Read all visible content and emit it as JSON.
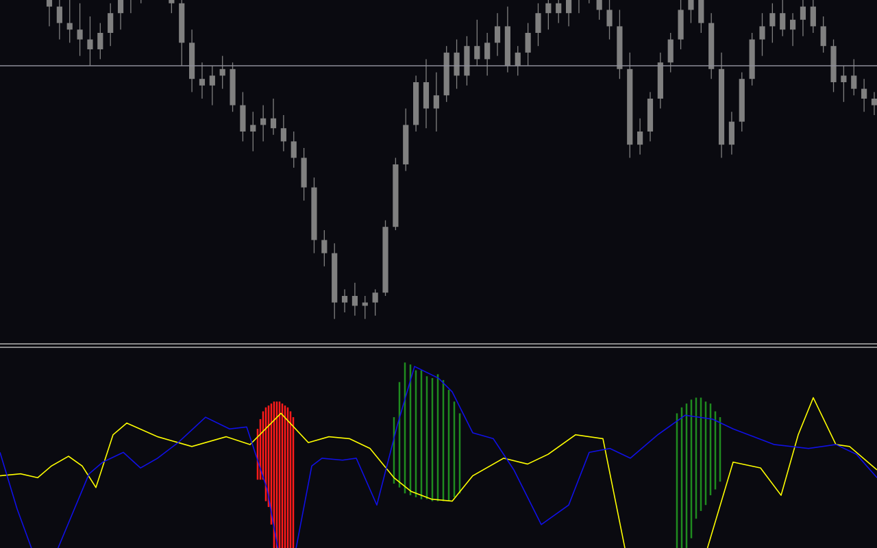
{
  "colors": {
    "background": "#0a0a10",
    "candle": "#808080",
    "level_line": "#8c8c98",
    "separator": "#b4b4b4",
    "fast_line": "#ffff00",
    "slow_line": "#1010e6",
    "hist_down": "#ff1a1a",
    "hist_up": "#1f8c1f"
  },
  "chart_data": [
    {
      "type": "candlestick",
      "title": "",
      "xlabel": "",
      "ylabel": "",
      "grid": false,
      "ylim": [
        0,
        100
      ],
      "horizontal_level": 80,
      "candles": [
        [
          100,
          104,
          92,
          98
        ],
        [
          98,
          106,
          88,
          93
        ],
        [
          93,
          102,
          87,
          91
        ],
        [
          91,
          99,
          83,
          88
        ],
        [
          88,
          95,
          80,
          85
        ],
        [
          85,
          93,
          82,
          90
        ],
        [
          90,
          99,
          86,
          96
        ],
        [
          96,
          104,
          91,
          101
        ],
        [
          101,
          108,
          96,
          104
        ],
        [
          104,
          109,
          99,
          106
        ],
        [
          106,
          110,
          101,
          104
        ],
        [
          104,
          108,
          100,
          102
        ],
        [
          102,
          106,
          96,
          99
        ],
        [
          99,
          102,
          80,
          87
        ],
        [
          87,
          91,
          72,
          76
        ],
        [
          76,
          81,
          70,
          74
        ],
        [
          74,
          80,
          68,
          77
        ],
        [
          77,
          83,
          73,
          79
        ],
        [
          79,
          81,
          66,
          68
        ],
        [
          68,
          72,
          57,
          60
        ],
        [
          60,
          66,
          54,
          62
        ],
        [
          62,
          68,
          57,
          64
        ],
        [
          64,
          70,
          59,
          61
        ],
        [
          61,
          65,
          54,
          57
        ],
        [
          57,
          60,
          49,
          52
        ],
        [
          52,
          55,
          39,
          43
        ],
        [
          43,
          46,
          23,
          27
        ],
        [
          27,
          30,
          19,
          23
        ],
        [
          23,
          26,
          3,
          8
        ],
        [
          8,
          12,
          5,
          10
        ],
        [
          10,
          14,
          4,
          7
        ],
        [
          7,
          10,
          3,
          8
        ],
        [
          8,
          12,
          4,
          11
        ],
        [
          11,
          33,
          10,
          31
        ],
        [
          31,
          52,
          30,
          50
        ],
        [
          50,
          67,
          48,
          62
        ],
        [
          62,
          77,
          60,
          75
        ],
        [
          75,
          82,
          61,
          67
        ],
        [
          67,
          78,
          60,
          71
        ],
        [
          71,
          86,
          69,
          84
        ],
        [
          84,
          88,
          73,
          77
        ],
        [
          77,
          89,
          74,
          86
        ],
        [
          86,
          94,
          80,
          82
        ],
        [
          82,
          90,
          77,
          87
        ],
        [
          87,
          96,
          83,
          92
        ],
        [
          92,
          98,
          78,
          80
        ],
        [
          80,
          86,
          77,
          84
        ],
        [
          84,
          93,
          80,
          90
        ],
        [
          90,
          99,
          86,
          96
        ],
        [
          96,
          102,
          91,
          99
        ],
        [
          99,
          102,
          93,
          96
        ],
        [
          96,
          104,
          92,
          101
        ],
        [
          101,
          107,
          96,
          104
        ],
        [
          104,
          109,
          99,
          102
        ],
        [
          102,
          106,
          94,
          97
        ],
        [
          97,
          101,
          88,
          92
        ],
        [
          92,
          97,
          76,
          79
        ],
        [
          79,
          84,
          52,
          56
        ],
        [
          56,
          64,
          53,
          60
        ],
        [
          60,
          72,
          57,
          70
        ],
        [
          70,
          84,
          67,
          81
        ],
        [
          81,
          90,
          78,
          88
        ],
        [
          88,
          100,
          85,
          97
        ],
        [
          97,
          104,
          93,
          100
        ],
        [
          100,
          103,
          90,
          93
        ],
        [
          93,
          96,
          76,
          79
        ],
        [
          79,
          84,
          52,
          56
        ],
        [
          56,
          66,
          53,
          63
        ],
        [
          63,
          78,
          60,
          76
        ],
        [
          76,
          90,
          74,
          88
        ],
        [
          88,
          96,
          83,
          92
        ],
        [
          92,
          99,
          87,
          96
        ],
        [
          96,
          102,
          89,
          91
        ],
        [
          91,
          96,
          86,
          94
        ],
        [
          94,
          100,
          89,
          98
        ],
        [
          98,
          102,
          90,
          92
        ],
        [
          92,
          95,
          84,
          86
        ],
        [
          86,
          88,
          72,
          75
        ],
        [
          75,
          80,
          69,
          77
        ],
        [
          77,
          82,
          71,
          73
        ],
        [
          73,
          76,
          66,
          70
        ],
        [
          70,
          72,
          65,
          68
        ]
      ]
    },
    {
      "type": "line",
      "title": "",
      "xlabel": "",
      "ylabel": "",
      "grid": false,
      "ylim": [
        0,
        100
      ],
      "series": [
        {
          "color_key": "fast_line",
          "x": [
            0,
            30,
            55,
            75,
            100,
            120,
            140,
            165,
            185,
            230,
            280,
            330,
            365,
            410,
            450,
            480,
            510,
            540,
            575,
            600,
            630,
            660,
            690,
            735,
            770,
            800,
            840,
            880,
            920,
            970,
            1030,
            1070,
            1110,
            1140,
            1165,
            1187,
            1220,
            1240,
            1280
          ],
          "y": [
            37,
            38,
            36,
            42,
            47,
            42,
            31,
            58,
            64,
            57,
            52,
            57,
            53,
            69,
            54,
            57,
            56,
            51,
            36,
            29,
            25,
            24,
            37,
            46,
            43,
            48,
            58,
            56,
            -14,
            -14,
            -3,
            44,
            41,
            27,
            58,
            77,
            53,
            52,
            40
          ]
        },
        {
          "color_key": "slow_line",
          "x": [
            0,
            25,
            50,
            80,
            105,
            130,
            150,
            180,
            205,
            230,
            260,
            300,
            335,
            360,
            390,
            410,
            430,
            455,
            470,
            500,
            520,
            550,
            580,
            605,
            640,
            660,
            690,
            720,
            750,
            790,
            830,
            860,
            890,
            920,
            960,
            1000,
            1040,
            1070,
            1100,
            1130,
            1180,
            1220,
            1250,
            1280
          ],
          "y": [
            49,
            20,
            -4,
            -4,
            17,
            38,
            44,
            49,
            41,
            46,
            54,
            67,
            61,
            62,
            30,
            -9,
            -4,
            42,
            46,
            45,
            46,
            22,
            63,
            93,
            87,
            80,
            59,
            56,
            40,
            12,
            22,
            49,
            51,
            46,
            58,
            68,
            66,
            61,
            57,
            53,
            51,
            53,
            48,
            36
          ]
        },
        {
          "color_key": "hist_down",
          "style": "histogram",
          "x": [
            376,
            380,
            384,
            388,
            392,
            396,
            400,
            404,
            408,
            412,
            416,
            420,
            424,
            428
          ],
          "y_top": [
            61,
            66,
            70,
            72,
            73,
            74,
            75,
            75,
            75,
            74,
            73,
            72,
            70,
            67
          ],
          "y_bottom": [
            35,
            35,
            35,
            24,
            21,
            12,
            -7,
            -7,
            -7,
            -7,
            -7,
            -7,
            -7,
            -7
          ]
        },
        {
          "color_key": "hist_up",
          "style": "histogram",
          "x": [
            575,
            583,
            591,
            599,
            607,
            615,
            623,
            631,
            639,
            647,
            655,
            663,
            671
          ],
          "y_top": [
            67,
            85,
            95,
            94,
            91,
            91,
            88,
            87,
            89,
            86,
            81,
            75,
            69
          ],
          "y_bottom": [
            33,
            31,
            28,
            27,
            26,
            25,
            25,
            24,
            24,
            24,
            24,
            26,
            28
          ]
        },
        {
          "color_key": "hist_up",
          "style": "histogram",
          "x": [
            988,
            995,
            1002,
            1009,
            1016,
            1023,
            1030,
            1037,
            1044,
            1051
          ],
          "y_top": [
            69,
            72,
            74,
            76,
            77,
            77,
            75,
            74,
            70,
            67
          ],
          "y_bottom": [
            -7,
            -7,
            -7,
            5,
            15,
            19,
            22,
            27,
            30,
            34
          ]
        }
      ]
    }
  ]
}
